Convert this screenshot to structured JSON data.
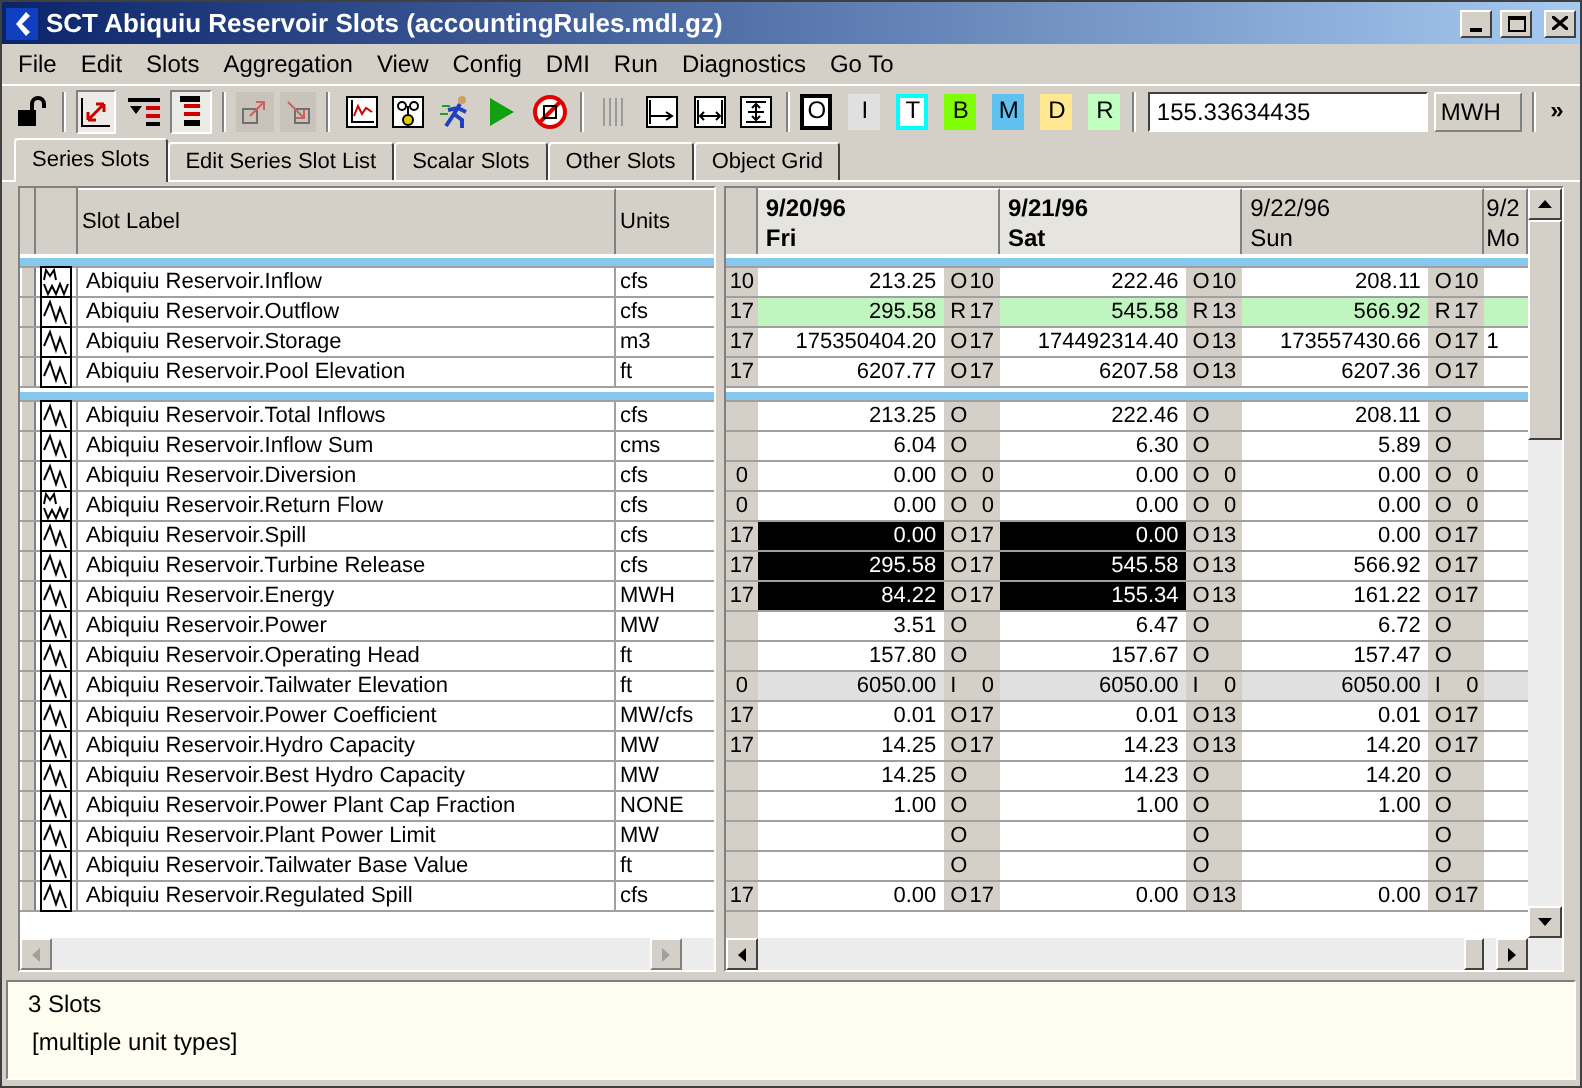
{
  "window": {
    "title": "SCT Abiquiu Reservoir Slots (accountingRules.mdl.gz)"
  },
  "menu": [
    "File",
    "Edit",
    "Slots",
    "Aggregation",
    "View",
    "Config",
    "DMI",
    "Run",
    "Diagnostics",
    "Go To"
  ],
  "toolbar": {
    "toggles": [
      {
        "pressed": true
      },
      {
        "pressed": false
      },
      {
        "pressed": true
      }
    ],
    "flags": [
      {
        "label": "O",
        "kind": "outlined",
        "color": "#000000"
      },
      {
        "label": "I",
        "kind": "filled",
        "color": "#e0e0e0"
      },
      {
        "label": "T",
        "kind": "outlined",
        "color": "#00ffff"
      },
      {
        "label": "B",
        "kind": "filled",
        "color": "#80ff00"
      },
      {
        "label": "M",
        "kind": "filled",
        "color": "#60c0f0"
      },
      {
        "label": "D",
        "kind": "filled",
        "color": "#ffe890"
      },
      {
        "label": "R",
        "kind": "filled",
        "color": "#c0ffc0"
      }
    ],
    "value": "155.33634435",
    "units": "MWH",
    "overflow": "»"
  },
  "tabs": [
    {
      "label": "Series Slots",
      "selected": true
    },
    {
      "label": "Edit Series Slot List",
      "selected": false
    },
    {
      "label": "Scalar Slots",
      "selected": false
    },
    {
      "label": "Other Slots",
      "selected": false
    },
    {
      "label": "Object Grid",
      "selected": false
    }
  ],
  "slot_table": {
    "columns": [
      "Slot Label",
      "Units"
    ]
  },
  "dates": [
    {
      "date": "9/20/96",
      "day": "Fri",
      "selected": true
    },
    {
      "date": "9/21/96",
      "day": "Sat",
      "selected": true
    },
    {
      "date": "9/22/96",
      "day": "Sun",
      "selected": false
    },
    {
      "date": "9/2",
      "day": "Mo",
      "selected": false
    }
  ],
  "groups": [
    {
      "rows": [
        {
          "kind": "multi",
          "label": "Abiquiu Reservoir.Inflow",
          "units": "cfs",
          "lead": "10",
          "cells": [
            {
              "value": "213.25",
              "flag": "O",
              "num": "10"
            },
            {
              "value": "222.46",
              "flag": "O",
              "num": "10"
            },
            {
              "value": "208.11",
              "flag": "O",
              "num": "10"
            }
          ]
        },
        {
          "kind": "single",
          "label": "Abiquiu Reservoir.Outflow",
          "units": "cfs",
          "lead": "17",
          "cells": [
            {
              "value": "295.58",
              "flag": "R",
              "num": "17",
              "color": "#c0f5c0"
            },
            {
              "value": "545.58",
              "flag": "R",
              "num": "13",
              "color": "#c0f5c0"
            },
            {
              "value": "566.92",
              "flag": "R",
              "num": "17",
              "color": "#c0f5c0"
            }
          ],
          "partial": {
            "color": "#c0f5c0"
          }
        },
        {
          "kind": "single",
          "label": "Abiquiu Reservoir.Storage",
          "units": "m3",
          "lead": "17",
          "cells": [
            {
              "value": "175350404.20",
              "flag": "O",
              "num": "17"
            },
            {
              "value": "174492314.40",
              "flag": "O",
              "num": "13"
            },
            {
              "value": "173557430.66",
              "flag": "O",
              "num": "17"
            }
          ],
          "partial": {
            "value": "1"
          }
        },
        {
          "kind": "single",
          "label": "Abiquiu Reservoir.Pool Elevation",
          "units": "ft",
          "lead": "17",
          "cells": [
            {
              "value": "6207.77",
              "flag": "O",
              "num": "17"
            },
            {
              "value": "6207.58",
              "flag": "O",
              "num": "13"
            },
            {
              "value": "6207.36",
              "flag": "O",
              "num": "17"
            }
          ]
        }
      ]
    },
    {
      "rows": [
        {
          "kind": "single",
          "label": "Abiquiu Reservoir.Total Inflows",
          "units": "cfs",
          "cells": [
            {
              "value": "213.25",
              "flag": "O"
            },
            {
              "value": "222.46",
              "flag": "O"
            },
            {
              "value": "208.11",
              "flag": "O"
            }
          ]
        },
        {
          "kind": "single",
          "label": "Abiquiu Reservoir.Inflow Sum",
          "units": "cms",
          "cells": [
            {
              "value": "6.04",
              "flag": "O"
            },
            {
              "value": "6.30",
              "flag": "O"
            },
            {
              "value": "5.89",
              "flag": "O"
            }
          ]
        },
        {
          "kind": "single",
          "label": "Abiquiu Reservoir.Diversion",
          "units": "cfs",
          "lead": "0",
          "cells": [
            {
              "value": "0.00",
              "flag": "O",
              "num": "0"
            },
            {
              "value": "0.00",
              "flag": "O",
              "num": "0"
            },
            {
              "value": "0.00",
              "flag": "O",
              "num": "0"
            }
          ]
        },
        {
          "kind": "multi",
          "label": "Abiquiu Reservoir.Return Flow",
          "units": "cfs",
          "lead": "0",
          "cells": [
            {
              "value": "0.00",
              "flag": "O",
              "num": "0"
            },
            {
              "value": "0.00",
              "flag": "O",
              "num": "0"
            },
            {
              "value": "0.00",
              "flag": "O",
              "num": "0"
            }
          ]
        },
        {
          "kind": "single",
          "label": "Abiquiu Reservoir.Spill",
          "units": "cfs",
          "lead": "17",
          "cells": [
            {
              "value": "0.00",
              "flag": "O",
              "num": "17",
              "selected": true
            },
            {
              "value": "0.00",
              "flag": "O",
              "num": "13",
              "selected": true
            },
            {
              "value": "0.00",
              "flag": "O",
              "num": "17",
              "selected": false
            }
          ]
        },
        {
          "kind": "single",
          "label": "Abiquiu Reservoir.Turbine Release",
          "units": "cfs",
          "lead": "17",
          "cells": [
            {
              "value": "295.58",
              "flag": "O",
              "num": "17",
              "selected": true
            },
            {
              "value": "545.58",
              "flag": "O",
              "num": "13",
              "selected": true
            },
            {
              "value": "566.92",
              "flag": "O",
              "num": "17",
              "selected": false
            }
          ]
        },
        {
          "kind": "single",
          "label": "Abiquiu Reservoir.Energy",
          "units": "MWH",
          "lead": "17",
          "cells": [
            {
              "value": "84.22",
              "flag": "O",
              "num": "17",
              "selected": true
            },
            {
              "value": "155.34",
              "flag": "O",
              "num": "13",
              "selected": true
            },
            {
              "value": "161.22",
              "flag": "O",
              "num": "17",
              "selected": false
            }
          ]
        },
        {
          "kind": "single",
          "label": "Abiquiu Reservoir.Power",
          "units": "MW",
          "cells": [
            {
              "value": "3.51",
              "flag": "O"
            },
            {
              "value": "6.47",
              "flag": "O"
            },
            {
              "value": "6.72",
              "flag": "O"
            }
          ]
        },
        {
          "kind": "single",
          "label": "Abiquiu Reservoir.Operating Head",
          "units": "ft",
          "cells": [
            {
              "value": "157.80",
              "flag": "O"
            },
            {
              "value": "157.67",
              "flag": "O"
            },
            {
              "value": "157.47",
              "flag": "O"
            }
          ]
        },
        {
          "kind": "single",
          "label": "Abiquiu Reservoir.Tailwater Elevation",
          "units": "ft",
          "lead": "0",
          "cells": [
            {
              "value": "6050.00",
              "flag": "I",
              "num": "0",
              "color": "#e0e0e0"
            },
            {
              "value": "6050.00",
              "flag": "I",
              "num": "0",
              "color": "#e0e0e0"
            },
            {
              "value": "6050.00",
              "flag": "I",
              "num": "0",
              "color": "#e0e0e0"
            }
          ],
          "partial": {
            "color": "#e0e0e0"
          }
        },
        {
          "kind": "single",
          "label": "Abiquiu Reservoir.Power Coefficient",
          "units": "MW/cfs",
          "lead": "17",
          "cells": [
            {
              "value": "0.01",
              "flag": "O",
              "num": "17"
            },
            {
              "value": "0.01",
              "flag": "O",
              "num": "13"
            },
            {
              "value": "0.01",
              "flag": "O",
              "num": "17"
            }
          ]
        },
        {
          "kind": "single",
          "label": "Abiquiu Reservoir.Hydro Capacity",
          "units": "MW",
          "lead": "17",
          "cells": [
            {
              "value": "14.25",
              "flag": "O",
              "num": "17"
            },
            {
              "value": "14.23",
              "flag": "O",
              "num": "13"
            },
            {
              "value": "14.20",
              "flag": "O",
              "num": "17"
            }
          ]
        },
        {
          "kind": "single",
          "label": "Abiquiu Reservoir.Best Hydro Capacity",
          "units": "MW",
          "cells": [
            {
              "value": "14.25",
              "flag": "O"
            },
            {
              "value": "14.23",
              "flag": "O"
            },
            {
              "value": "14.20",
              "flag": "O"
            }
          ]
        },
        {
          "kind": "single",
          "label": "Abiquiu Reservoir.Power Plant Cap Fraction",
          "units": "NONE",
          "cells": [
            {
              "value": "1.00",
              "flag": "O"
            },
            {
              "value": "1.00",
              "flag": "O"
            },
            {
              "value": "1.00",
              "flag": "O"
            }
          ]
        },
        {
          "kind": "single",
          "label": "Abiquiu Reservoir.Plant Power Limit",
          "units": "MW",
          "cells": [
            {
              "flag": "O"
            },
            {
              "flag": "O"
            },
            {
              "flag": "O"
            }
          ]
        },
        {
          "kind": "single",
          "label": "Abiquiu Reservoir.Tailwater Base Value",
          "units": "ft",
          "cells": [
            {
              "flag": "O"
            },
            {
              "flag": "O"
            },
            {
              "flag": "O"
            }
          ]
        },
        {
          "kind": "single",
          "label": "Abiquiu Reservoir.Regulated Spill",
          "units": "cfs",
          "lead": "17",
          "cells": [
            {
              "value": "0.00",
              "flag": "O",
              "num": "17"
            },
            {
              "value": "0.00",
              "flag": "O",
              "num": "13"
            },
            {
              "value": "0.00",
              "flag": "O",
              "num": "17"
            }
          ]
        }
      ]
    }
  ],
  "info": [
    "3 Slots",
    "[multiple unit types]"
  ]
}
